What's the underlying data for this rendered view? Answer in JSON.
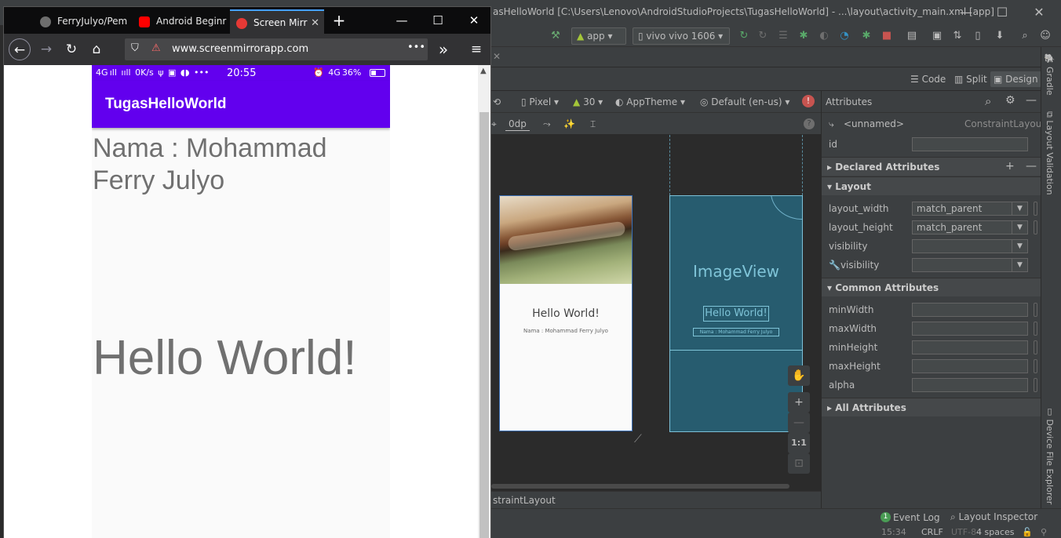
{
  "android_studio": {
    "title": "asHelloWorld [C:\\Users\\Lenovo\\AndroidStudioProjects\\TugasHelloWorld] - ...\\layout\\activity_main.xml [app]",
    "toolbar": {
      "run_config": "app",
      "device": "vivo vivo 1606"
    },
    "view_modes": [
      "Code",
      "Split",
      "Design"
    ],
    "design_toolbar": {
      "device": "Pixel",
      "api": "30",
      "theme": "AppTheme",
      "locale": "Default (en-us)",
      "margin": "0dp"
    },
    "design_preview": {
      "hello": "Hello World!",
      "nama": "Nama : Mohammad Ferry Julyo"
    },
    "blueprint": {
      "imageview": "ImageView",
      "hello": "Hello World!",
      "nama": "Nama : Mohammad Ferry Julyo"
    },
    "zoom": {
      "plus": "+",
      "minus": "—",
      "one_to_one": "1:1"
    },
    "attributes": {
      "header": "Attributes",
      "component_name": "<unnamed>",
      "component_type": "ConstraintLayout",
      "id_label": "id",
      "sections": {
        "declared": "Declared Attributes",
        "layout": "Layout",
        "common": "Common Attributes",
        "all": "All Attributes"
      },
      "layout_rows": [
        {
          "label": "layout_width",
          "value": "match_parent"
        },
        {
          "label": "layout_height",
          "value": "match_parent"
        },
        {
          "label": "visibility",
          "value": ""
        },
        {
          "label": "visibility",
          "value": ""
        }
      ],
      "common_rows": [
        {
          "label": "minWidth"
        },
        {
          "label": "maxWidth"
        },
        {
          "label": "minHeight"
        },
        {
          "label": "maxHeight"
        },
        {
          "label": "alpha"
        }
      ]
    },
    "side_tools": {
      "gradle": "Gradle",
      "layout_validation": "Layout Validation",
      "device_file_explorer": "Device File Explorer"
    },
    "breadcrumb": "straintLayout",
    "bottom_tools": {
      "event_log_count": "1",
      "event_log": "Event Log",
      "layout_inspector": "Layout Inspector"
    },
    "status_bar": {
      "position": "15:34",
      "line_sep": "CRLF",
      "encoding": "UTF-8",
      "indent": "4 spaces"
    }
  },
  "browser": {
    "tabs": [
      {
        "label": "FerryJulyo/Pem",
        "fav_color": "#6e6e6e"
      },
      {
        "label": "Android Beginr",
        "fav_color": "#ff0000"
      },
      {
        "label": "Screen Mirr",
        "fav_color": "#e53935"
      }
    ],
    "new_tab": "+",
    "url": "www.screenmirrorapp.com",
    "page_actions": "•••",
    "overflow": "»",
    "menu": "≡"
  },
  "phone": {
    "status_left": "4G ıll ııll 0K/s ψ ▣ ◖◗ •••",
    "time": "20:55",
    "status_right": "⏰ 4G 36%",
    "app_title": "TugasHelloWorld",
    "nama": "Nama : Mohammad Ferry Julyo",
    "hello": "Hello World!"
  },
  "colors": {
    "primary": "#6200ee",
    "ide_bg": "#3c3f41",
    "blueprint": "#275c6f"
  }
}
